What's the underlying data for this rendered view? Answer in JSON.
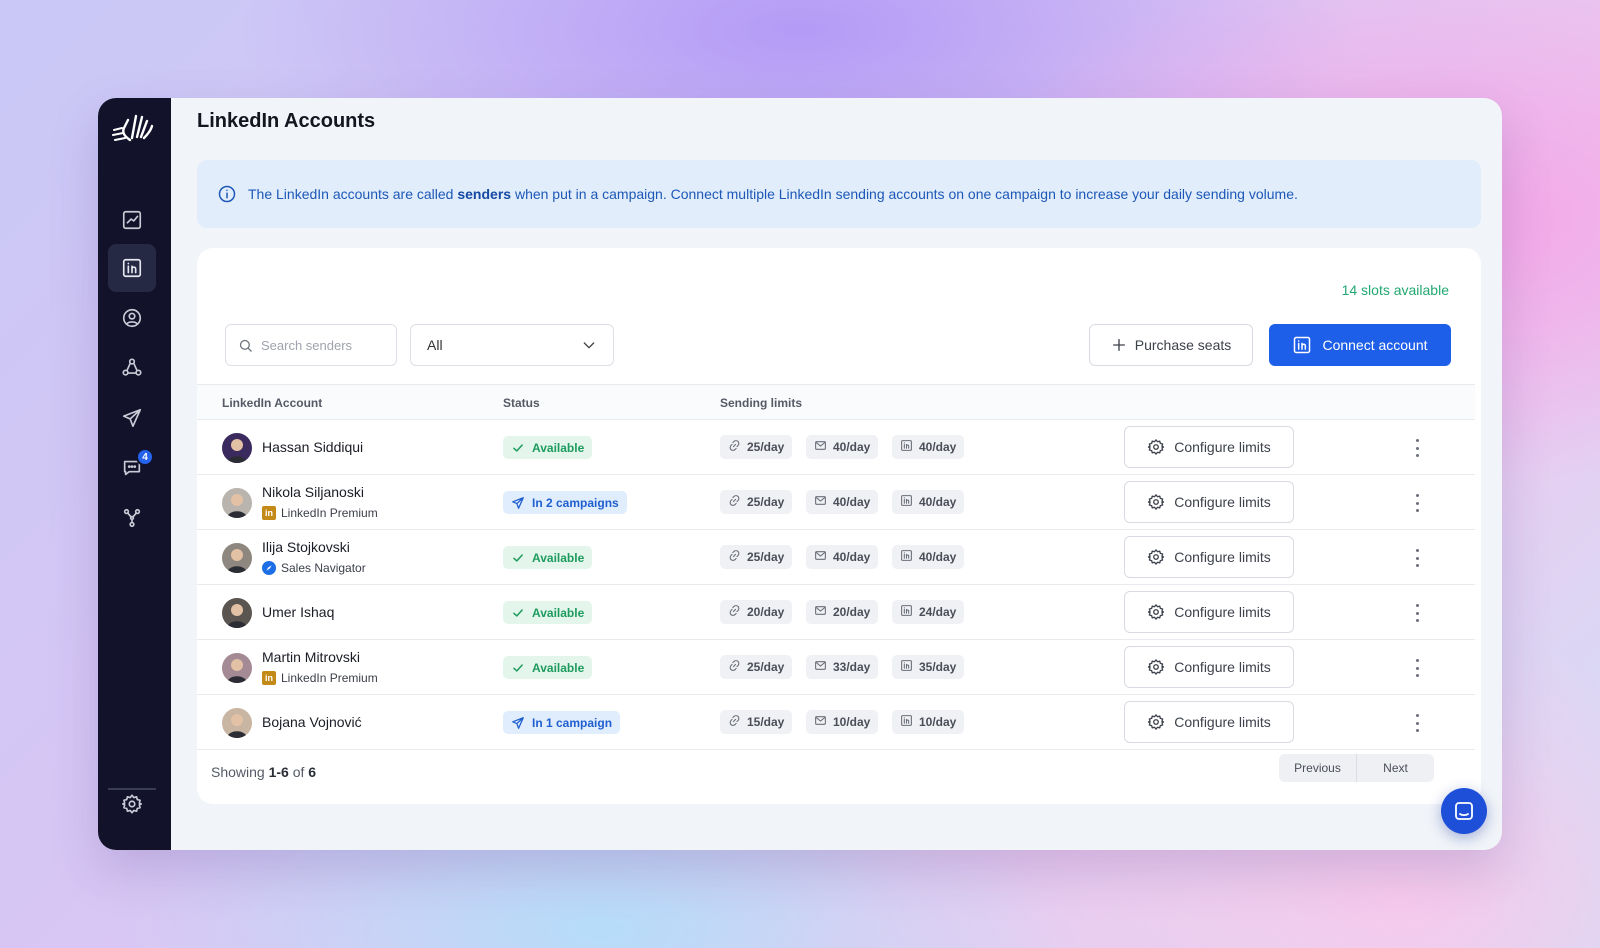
{
  "page": {
    "title": "LinkedIn Accounts"
  },
  "info": {
    "prefix": "The LinkedIn accounts are called ",
    "highlight": "senders",
    "suffix": " when put in a campaign. Connect multiple LinkedIn sending accounts on one campaign to increase your daily sending volume."
  },
  "sidebar": {
    "items": [
      {
        "name": "analytics",
        "icon": "chart-icon"
      },
      {
        "name": "linkedin-accounts",
        "icon": "linkedin-icon",
        "active": true
      },
      {
        "name": "contacts",
        "icon": "user-circle-icon"
      },
      {
        "name": "network",
        "icon": "network-icon"
      },
      {
        "name": "campaigns",
        "icon": "send-icon"
      },
      {
        "name": "messages",
        "icon": "chat-icon",
        "badge": "4"
      },
      {
        "name": "integrations",
        "icon": "hub-icon"
      }
    ],
    "settings_icon": "gear-icon"
  },
  "toolbar": {
    "slots_text": "14 slots available",
    "search_placeholder": "Search senders",
    "filter_value": "All",
    "purchase_label": "Purchase seats",
    "connect_label": "Connect account"
  },
  "table": {
    "headers": {
      "account": "LinkedIn Account",
      "status": "Status",
      "limits": "Sending limits"
    },
    "configure_label": "Configure limits",
    "rows": [
      {
        "name": "Hassan Siddiqui",
        "sub": "",
        "sub_type": "",
        "status": "Available",
        "status_type": "available",
        "connections": "25/day",
        "messages": "40/day",
        "inmails": "40/day",
        "avatar_color": "#3b2a5e"
      },
      {
        "name": "Nikola Siljanoski",
        "sub": "LinkedIn Premium",
        "sub_type": "premium",
        "status": "In 2 campaigns",
        "status_type": "campaign",
        "connections": "25/day",
        "messages": "40/day",
        "inmails": "40/day",
        "avatar_color": "#b9b4ad"
      },
      {
        "name": "Ilija Stojkovski",
        "sub": "Sales Navigator",
        "sub_type": "navigator",
        "status": "Available",
        "status_type": "available",
        "connections": "25/day",
        "messages": "40/day",
        "inmails": "40/day",
        "avatar_color": "#8e8780"
      },
      {
        "name": "Umer Ishaq",
        "sub": "",
        "sub_type": "",
        "status": "Available",
        "status_type": "available",
        "connections": "20/day",
        "messages": "20/day",
        "inmails": "24/day",
        "avatar_color": "#5a5550"
      },
      {
        "name": "Martin Mitrovski",
        "sub": "LinkedIn Premium",
        "sub_type": "premium",
        "status": "Available",
        "status_type": "available",
        "connections": "25/day",
        "messages": "33/day",
        "inmails": "35/day",
        "avatar_color": "#a48a94"
      },
      {
        "name": "Bojana Vojnović",
        "sub": "",
        "sub_type": "",
        "status": "In 1 campaign",
        "status_type": "campaign",
        "connections": "15/day",
        "messages": "10/day",
        "inmails": "10/day",
        "avatar_color": "#c9b6a2"
      }
    ]
  },
  "footer": {
    "showing_prefix": "Showing ",
    "range": "1-6",
    "of": " of ",
    "total": "6",
    "previous": "Previous",
    "next": "Next"
  },
  "colors": {
    "primary": "#1d5fe8",
    "available": "#1e9b5e",
    "campaign": "#1f5fd0",
    "sidebar": "#12122b"
  }
}
